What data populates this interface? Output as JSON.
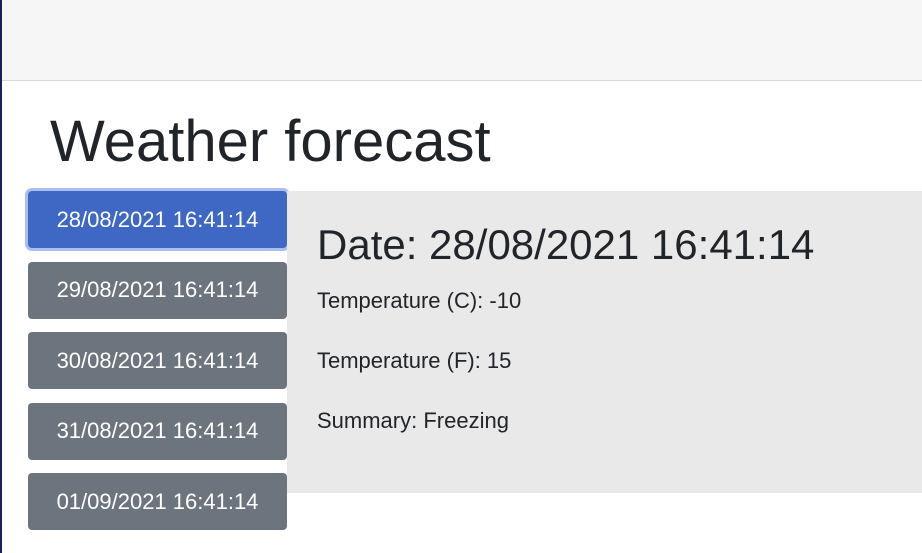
{
  "header": {
    "title": "Weather forecast"
  },
  "forecast_dates": [
    {
      "label": "28/08/2021 16:41:14",
      "selected": true
    },
    {
      "label": "29/08/2021 16:41:14",
      "selected": false
    },
    {
      "label": "30/08/2021 16:41:14",
      "selected": false
    },
    {
      "label": "31/08/2021 16:41:14",
      "selected": false
    },
    {
      "label": "01/09/2021 16:41:14",
      "selected": false
    }
  ],
  "detail": {
    "date_label": "Date: 28/08/2021 16:41:14",
    "temp_c_label": "Temperature (C): -10",
    "temp_f_label": "Temperature (F): 15",
    "summary_label": "Summary: Freezing"
  },
  "colors": {
    "selected_button": "#3e68c4",
    "unselected_button": "#6c757d",
    "panel_background": "#e9e9e9"
  }
}
